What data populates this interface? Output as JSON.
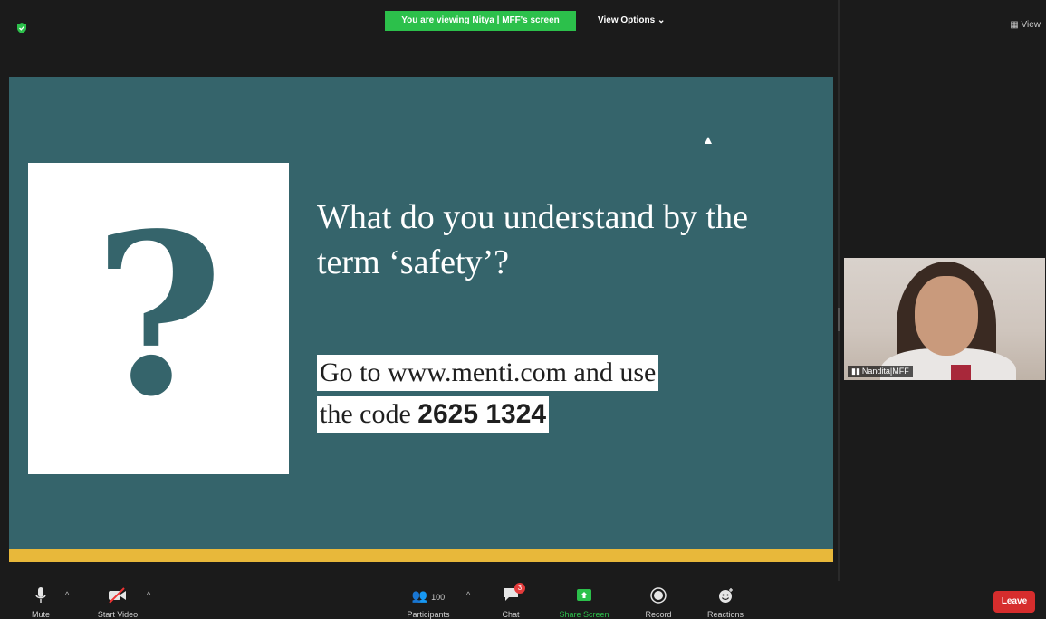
{
  "top_bar": {
    "viewing_banner": "You are viewing Nitya | MFF's screen",
    "view_options": "View Options ⌄",
    "view_label": "View"
  },
  "slide": {
    "question_mark": "?",
    "question": "What do you understand by the term ‘safety’?",
    "instruction_line1": "Go to www.menti.com and use",
    "instruction_line2_prefix": "the code ",
    "code": "2625 1324",
    "colors": {
      "background": "#35646b",
      "stripe": "#e8b83a"
    }
  },
  "participant": {
    "name": "Nandita|MFF"
  },
  "toolbar": {
    "mute_label": "Mute",
    "start_video_label": "Start Video",
    "participants_label": "Participants",
    "participants_count": "100",
    "chat_label": "Chat",
    "chat_badge": "3",
    "share_screen_label": "Share Screen",
    "record_label": "Record",
    "reactions_label": "Reactions",
    "leave_label": "Leave"
  }
}
